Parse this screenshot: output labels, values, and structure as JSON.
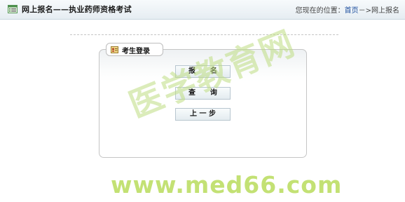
{
  "header": {
    "icon": "list-window-icon",
    "title": "网上报名——执业药师资格考试",
    "location_label": "您现在的位置：",
    "home_link": "首页",
    "separator": "－>",
    "current": "网上报名"
  },
  "panel": {
    "icon": "id-card-icon",
    "title": "考生登录",
    "buttons": [
      {
        "label": "报      名"
      },
      {
        "label": "查      询"
      },
      {
        "label": "上 一 步"
      }
    ]
  },
  "watermark": {
    "chinese": "医学教育网",
    "url": "www.med66.com"
  },
  "colors": {
    "header_bg": "#e6edf2",
    "link": "#1d4e9e",
    "watermark": "#b4d846"
  }
}
